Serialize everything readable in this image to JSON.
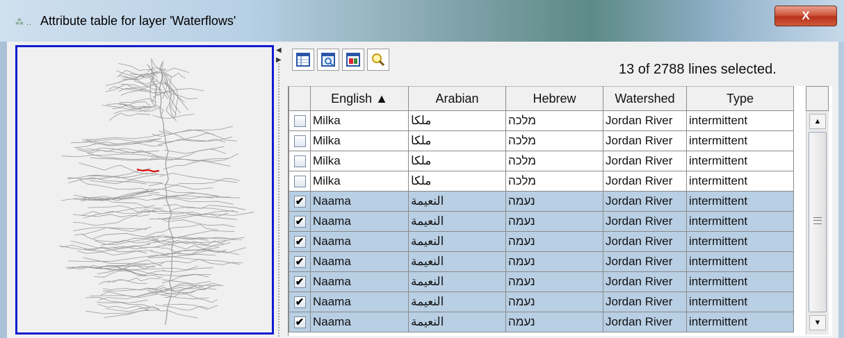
{
  "window": {
    "title": "Attribute table for layer 'Waterflows'",
    "close_label": "X"
  },
  "toolbar": {
    "buttons": [
      "table-icon",
      "zoom-selection-icon",
      "export-icon",
      "search-icon"
    ],
    "selection_status": "13 of 2788 lines selected."
  },
  "table": {
    "columns": [
      "English ▲",
      "Arabian",
      "Hebrew",
      "Watershed",
      "Type"
    ],
    "rows": [
      {
        "checked": "",
        "selected": false,
        "english": "Milka",
        "arabian": "ملكا",
        "hebrew": "מלכה",
        "watershed": "Jordan River",
        "type": "intermittent"
      },
      {
        "checked": "",
        "selected": false,
        "english": "Milka",
        "arabian": "ملكا",
        "hebrew": "מלכה",
        "watershed": "Jordan River",
        "type": "intermittent"
      },
      {
        "checked": "",
        "selected": false,
        "english": "Milka",
        "arabian": "ملكا",
        "hebrew": "מלכה",
        "watershed": "Jordan River",
        "type": "intermittent"
      },
      {
        "checked": "",
        "selected": false,
        "english": "Milka",
        "arabian": "ملكا",
        "hebrew": "מלכה",
        "watershed": "Jordan River",
        "type": "intermittent"
      },
      {
        "checked": "✔",
        "selected": true,
        "english": "Naama",
        "arabian": "النعيمة",
        "hebrew": "נעמה",
        "watershed": "Jordan River",
        "type": "intermittent"
      },
      {
        "checked": "✔",
        "selected": true,
        "english": "Naama",
        "arabian": "النعيمة",
        "hebrew": "נעמה",
        "watershed": "Jordan River",
        "type": "intermittent"
      },
      {
        "checked": "✔",
        "selected": true,
        "english": "Naama",
        "arabian": "النعيمة",
        "hebrew": "נעמה",
        "watershed": "Jordan River",
        "type": "intermittent"
      },
      {
        "checked": "✔",
        "selected": true,
        "english": "Naama",
        "arabian": "النعيمة",
        "hebrew": "נעמה",
        "watershed": "Jordan River",
        "type": "intermittent"
      },
      {
        "checked": "✔",
        "selected": true,
        "english": "Naama",
        "arabian": "النعيمة",
        "hebrew": "נעמה",
        "watershed": "Jordan River",
        "type": "intermittent"
      },
      {
        "checked": "✔",
        "selected": true,
        "english": "Naama",
        "arabian": "النعيمة",
        "hebrew": "נעמה",
        "watershed": "Jordan River",
        "type": "intermittent"
      },
      {
        "checked": "✔",
        "selected": true,
        "english": "Naama",
        "arabian": "النعيمة",
        "hebrew": "נעמה",
        "watershed": "Jordan River",
        "type": "intermittent"
      }
    ]
  },
  "scrollbar": {
    "up_arrow": "▲",
    "down_arrow": "▼"
  },
  "colors": {
    "selected_row": "#b8cfe4",
    "map_border": "#0f1ccf",
    "highlight_feature": "#e00000"
  }
}
